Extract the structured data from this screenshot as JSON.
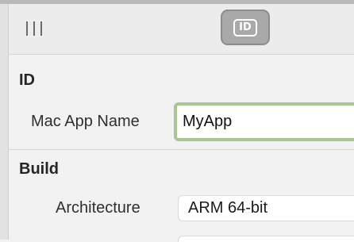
{
  "toolbar": {
    "sidebar_toggle_icon": "sidebar-toggle-icon",
    "id_button_icon": "id-card-icon",
    "id_button_text": "ID"
  },
  "sections": {
    "id": {
      "title": "ID",
      "mac_app_name_label": "Mac App Name",
      "mac_app_name_value": "MyApp"
    },
    "build": {
      "title": "Build",
      "architecture_label": "Architecture",
      "architecture_value": "ARM 64-bit"
    }
  },
  "colors": {
    "focus_ring": "#a9c690",
    "selected_toolbar_button": "#a9a9a9"
  }
}
